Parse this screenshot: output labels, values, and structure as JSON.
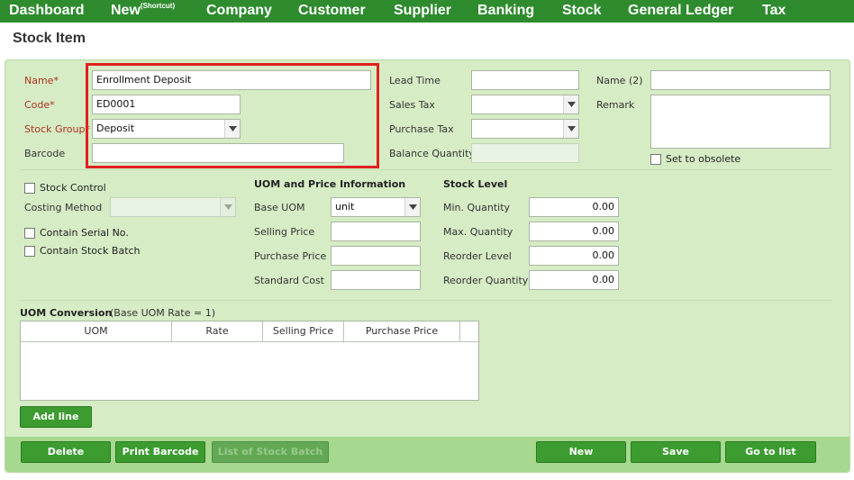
{
  "nav": {
    "items": [
      {
        "label": "Dashboard"
      },
      {
        "label": "New",
        "sup": "(Shortcut)"
      },
      {
        "label": "Company"
      },
      {
        "label": "Customer"
      },
      {
        "label": "Supplier"
      },
      {
        "label": "Banking"
      },
      {
        "label": "Stock"
      },
      {
        "label": "General Ledger"
      },
      {
        "label": "Tax"
      }
    ]
  },
  "page": {
    "title": "Stock Item"
  },
  "form": {
    "name_label": "Name*",
    "name_value": "Enrollment Deposit",
    "code_label": "Code*",
    "code_value": "ED0001",
    "stock_group_label": "Stock Group*",
    "stock_group_value": "Deposit",
    "barcode_label": "Barcode",
    "barcode_value": "",
    "lead_time_label": "Lead Time",
    "lead_time_value": "",
    "sales_tax_label": "Sales Tax",
    "sales_tax_value": "",
    "purchase_tax_label": "Purchase Tax",
    "purchase_tax_value": "",
    "balance_qty_label": "Balance Quantity",
    "balance_qty_value": "",
    "name2_label": "Name (2)",
    "name2_value": "",
    "remark_label": "Remark",
    "remark_value": "",
    "obsolete_label": "Set to obsolete",
    "stock_control_label": "Stock Control",
    "costing_method_label": "Costing Method",
    "costing_method_value": "",
    "serial_label": "Contain Serial No.",
    "batch_label": "Contain Stock Batch"
  },
  "uom": {
    "heading": "UOM and Price Information",
    "base_uom_label": "Base UOM",
    "base_uom_value": "unit",
    "selling_price_label": "Selling Price",
    "selling_price_value": "",
    "purchase_price_label": "Purchase Price",
    "purchase_price_value": "",
    "standard_cost_label": "Standard Cost",
    "standard_cost_value": ""
  },
  "stock_level": {
    "heading": "Stock Level",
    "min_label": "Min. Quantity",
    "min_value": "0.00",
    "max_label": "Max. Quantity",
    "max_value": "0.00",
    "reorder_level_label": "Reorder Level",
    "reorder_level_value": "0.00",
    "reorder_qty_label": "Reorder Quantity",
    "reorder_qty_value": "0.00"
  },
  "conversion": {
    "heading": "UOM Conversion",
    "note": "(Base UOM Rate = 1)",
    "columns": [
      "UOM",
      "Rate",
      "Selling Price",
      "Purchase Price"
    ],
    "add_line_label": "Add line"
  },
  "buttons": {
    "delete": "Delete",
    "print_barcode": "Print Barcode",
    "list_stock_batch": "List of Stock Batch",
    "new": "New",
    "save": "Save",
    "go_to_list": "Go to list"
  },
  "colors": {
    "nav_bg": "#2e8b2e",
    "panel_bg": "#d5ecc5",
    "button_bg": "#3c9c30",
    "highlight": "#e02020",
    "required_label": "#b03020"
  }
}
